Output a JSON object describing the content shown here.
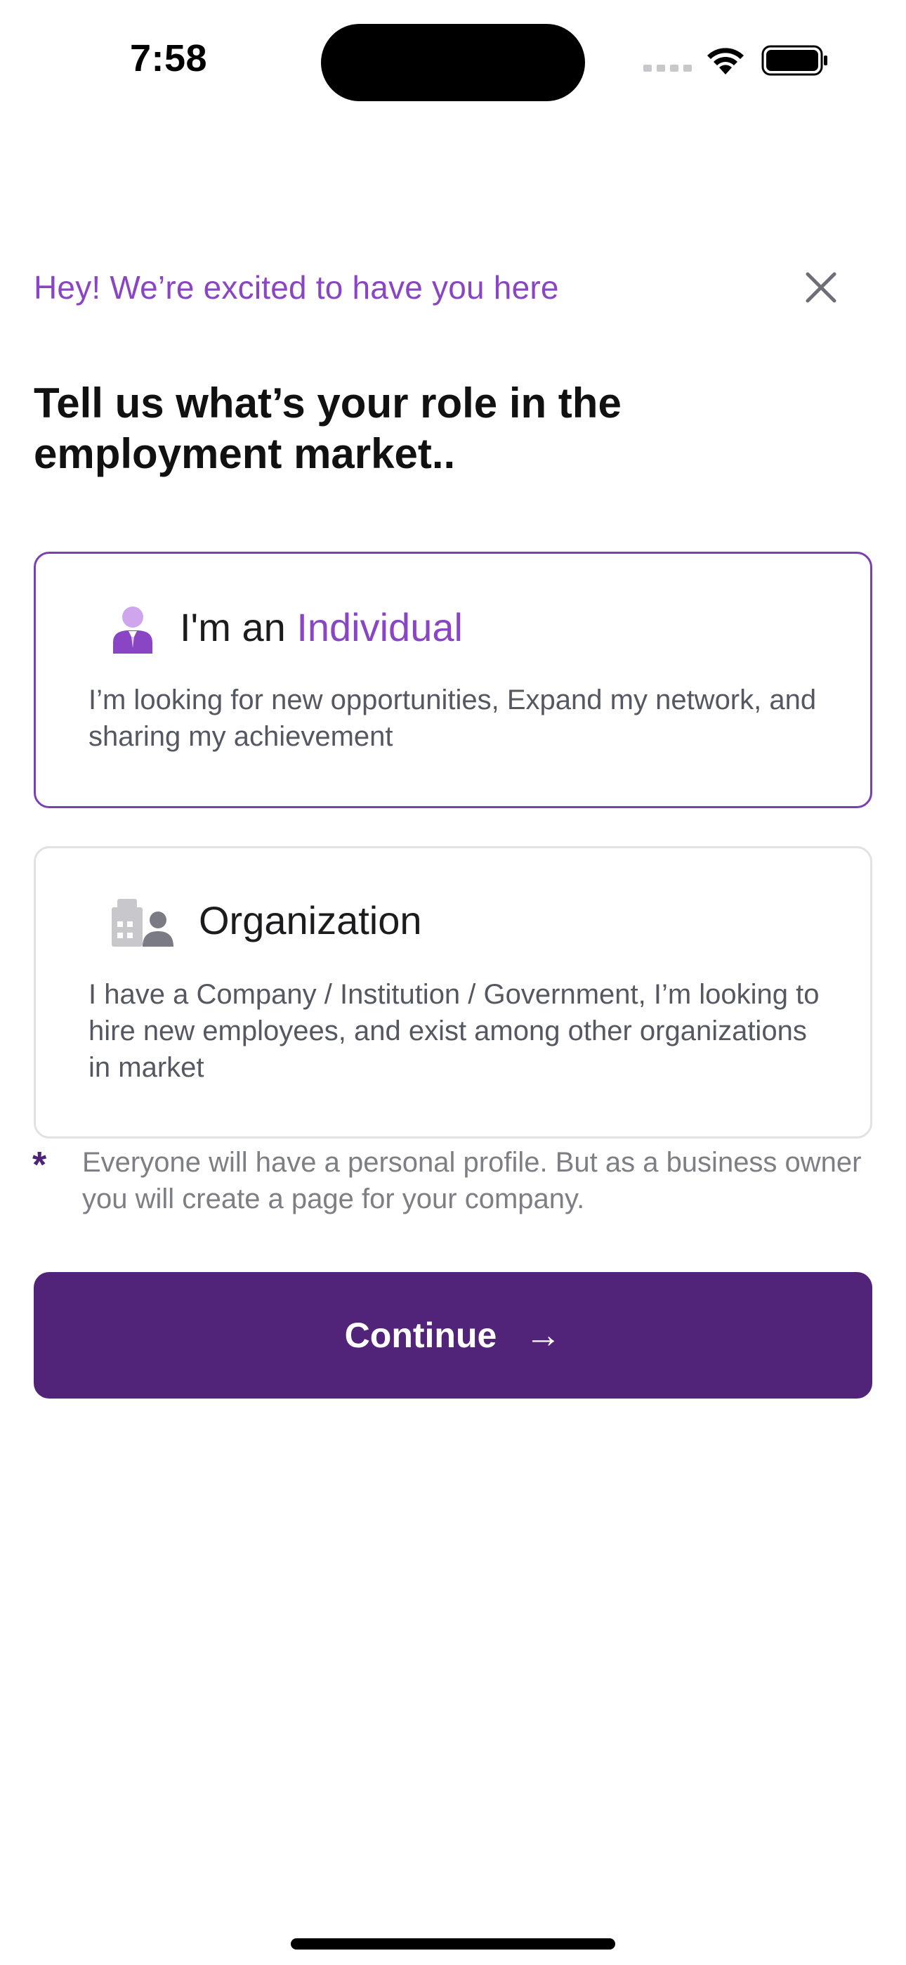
{
  "status_bar": {
    "time": "7:58"
  },
  "greeting": "Hey! We’re excited to have you here",
  "headline": "Tell us what’s your role in the employment market..",
  "options": [
    {
      "title_prefix": "I'm an ",
      "title_accent": "Individual",
      "description": "I’m looking for new opportunities, Expand my network, and sharing my achievement",
      "icon": "person-icon",
      "selected": true
    },
    {
      "title_prefix": "Organization",
      "title_accent": "",
      "description": "I have a Company / Institution / Government, I’m looking to hire new employees, and exist among other organizations in market",
      "icon": "building-person-icon",
      "selected": false
    }
  ],
  "note": {
    "marker": "*",
    "text": "Everyone will have a personal profile. But as a business owner you will create a page for your company."
  },
  "continue_button": {
    "label": "Continue",
    "arrow": "→"
  },
  "colors": {
    "accent": "#8a45c4",
    "primary": "#512479",
    "selected_border": "#7b3fb5",
    "unselected_border": "#e1e1e6"
  }
}
